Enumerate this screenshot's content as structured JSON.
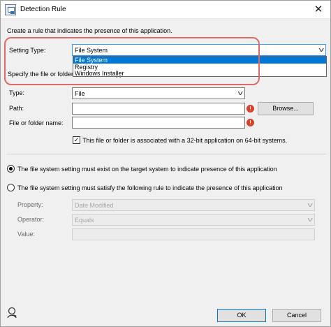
{
  "window": {
    "title": "Detection Rule",
    "close_glyph": "✕"
  },
  "intro_text": "Create a rule that indicates the presence of this application.",
  "setting_type": {
    "label": "Setting Type:",
    "selected": "File System",
    "options": [
      "File System",
      "Registry",
      "Windows Installer"
    ]
  },
  "specify_text": "Specify the file or folder to detect this application.",
  "file_section": {
    "type_label": "Type:",
    "type_value": "File",
    "path_label": "Path:",
    "path_value": "",
    "browse_label": "Browse...",
    "name_label": "File or folder name:",
    "name_value": "",
    "error_glyph": "!",
    "checkbox_label": "This file or folder is associated with a 32-bit application on 64-bit systems.",
    "checkbox_checked": true
  },
  "rules": {
    "option1_label": "The file system setting must exist on the target system to indicate presence of this application",
    "option1_selected": true,
    "option2_label": "The file system setting must satisfy the following rule to indicate the presence of this application",
    "option2_selected": false,
    "property_label": "Property:",
    "property_value": "Date Modified",
    "operator_label": "Operator:",
    "operator_value": "Equals",
    "value_label": "Value:",
    "value_value": ""
  },
  "footer": {
    "ok_label": "OK",
    "cancel_label": "Cancel"
  },
  "colors": {
    "selection_blue": "#0078d7",
    "highlight_red": "#e06a6a",
    "error_red": "#d9402b"
  }
}
